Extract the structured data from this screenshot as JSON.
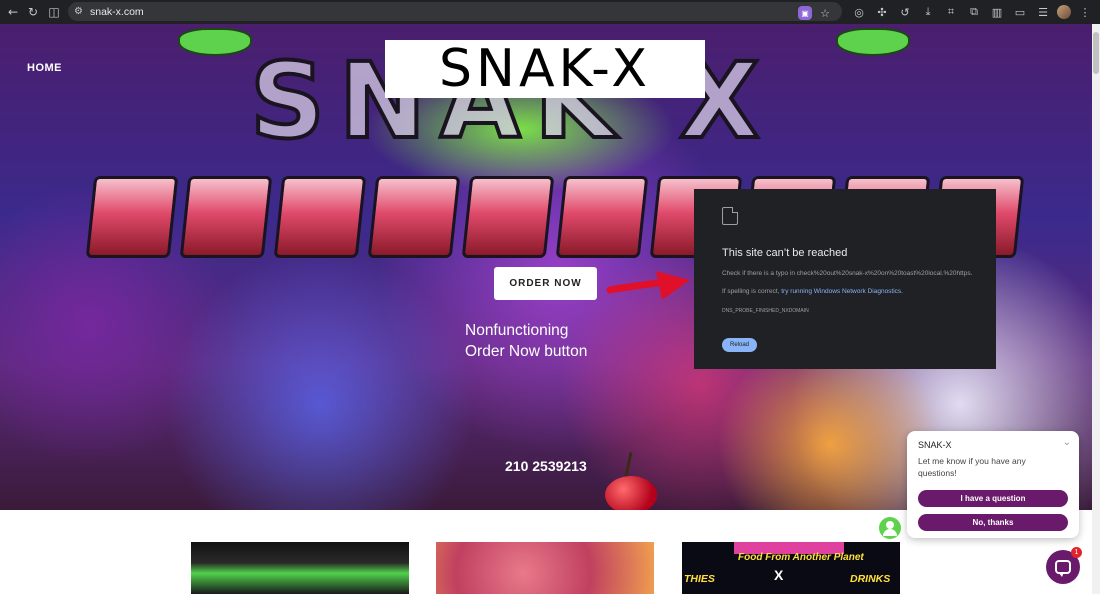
{
  "browser": {
    "url": "snak-x.com",
    "icons": [
      "back-icon",
      "reload-icon",
      "sidepanel-icon",
      "tune-icon",
      "extension-icon",
      "star-icon",
      "ext-icon",
      "puzzle-icon",
      "history-icon",
      "download-icon",
      "translate-icon",
      "tab-icon",
      "split-icon",
      "cast-icon",
      "menu-list-icon",
      "profile-icon",
      "kebab-icon"
    ]
  },
  "site": {
    "nav_home": "HOME",
    "logo_text": "SNAK-X",
    "order_button": "ORDER NOW",
    "annotation_line1": "Nonfunctioning",
    "annotation_line2": "Order Now button",
    "phone": "210 2539213"
  },
  "error_page": {
    "title": "This site can’t be reached",
    "line1": "Check if there is a typo in check%20out%20snak-x%20on%20toast%20local.%20https.",
    "line2_prefix": "If spelling is correct,",
    "line2_link": "try running Windows Network Diagnostics.",
    "code": "DNS_PROBE_FINISHED_NXDOMAIN",
    "reload": "Reload"
  },
  "cards": {
    "card3_tagline": "Food From Another Planet",
    "card3_left": "THIES",
    "card3_center": "X",
    "card3_right": "DRINKS"
  },
  "chat": {
    "name": "SNAK-X",
    "message": "Let me know if you have any questions!",
    "button1": "I have a question",
    "button2": "No, thanks",
    "badge": "1"
  },
  "colors": {
    "chat_purple": "#6a1a6a",
    "arrow_red": "#e0102a",
    "error_bg": "#202124",
    "link_blue": "#8ab4f8"
  }
}
